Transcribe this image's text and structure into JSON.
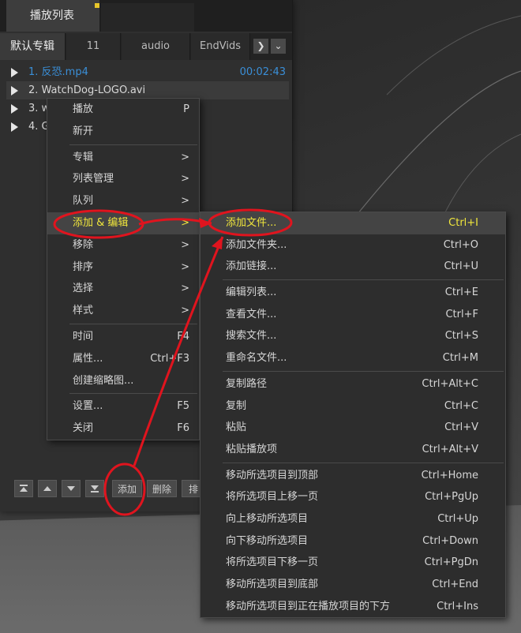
{
  "window": {
    "tab_title": "播放列表"
  },
  "album_tabs": [
    {
      "label": "默认专辑",
      "active": true
    },
    {
      "label": "11"
    },
    {
      "label": "audio"
    },
    {
      "label": "EndVids"
    }
  ],
  "nav_icons": {
    "next": "chevron-right-icon",
    "more": "chevron-down-icon"
  },
  "nav_glyphs": {
    "next": "❯",
    "more": "⌄"
  },
  "playlist": [
    {
      "label": "1. 反恐.mp4",
      "duration": "00:02:43",
      "state": "playing"
    },
    {
      "label": "2. WatchDog-LOGO.avi",
      "state": "selected"
    },
    {
      "label": "3. w"
    },
    {
      "label": "4. G"
    }
  ],
  "bottom_bar": {
    "add_label": "添加",
    "delete_label": "删除",
    "sort_label": "排"
  },
  "context_menu": [
    {
      "label": "播放",
      "shortcut": "P"
    },
    {
      "label": "新开",
      "shortcut": ""
    },
    {
      "sep": true
    },
    {
      "label": "专辑",
      "shortcut": ">"
    },
    {
      "label": "列表管理",
      "shortcut": ">"
    },
    {
      "label": "队列",
      "shortcut": ">"
    },
    {
      "label": "添加 & 编辑",
      "shortcut": ">",
      "highlighted": true
    },
    {
      "label": "移除",
      "shortcut": ">"
    },
    {
      "label": "排序",
      "shortcut": ">"
    },
    {
      "label": "选择",
      "shortcut": ">"
    },
    {
      "label": "样式",
      "shortcut": ">"
    },
    {
      "sep": true
    },
    {
      "label": "时间",
      "shortcut": "F4"
    },
    {
      "label": "属性...",
      "shortcut": "Ctrl+F3"
    },
    {
      "label": "创建缩略图...",
      "shortcut": ""
    },
    {
      "sep": true
    },
    {
      "label": "设置...",
      "shortcut": "F5"
    },
    {
      "label": "关闭",
      "shortcut": "F6"
    }
  ],
  "submenu": [
    {
      "label": "添加文件...",
      "shortcut": "Ctrl+I",
      "highlighted": true
    },
    {
      "label": "添加文件夹...",
      "shortcut": "Ctrl+O"
    },
    {
      "label": "添加链接...",
      "shortcut": "Ctrl+U"
    },
    {
      "sep": true
    },
    {
      "label": "编辑列表...",
      "shortcut": "Ctrl+E"
    },
    {
      "label": "查看文件...",
      "shortcut": "Ctrl+F"
    },
    {
      "label": "搜索文件...",
      "shortcut": "Ctrl+S"
    },
    {
      "label": "重命名文件...",
      "shortcut": "Ctrl+M"
    },
    {
      "sep": true
    },
    {
      "label": "复制路径",
      "shortcut": "Ctrl+Alt+C"
    },
    {
      "label": "复制",
      "shortcut": "Ctrl+C"
    },
    {
      "label": "粘贴",
      "shortcut": "Ctrl+V"
    },
    {
      "label": "粘贴播放项",
      "shortcut": "Ctrl+Alt+V"
    },
    {
      "sep": true
    },
    {
      "label": "移动所选项目到顶部",
      "shortcut": "Ctrl+Home"
    },
    {
      "label": "将所选项目上移一页",
      "shortcut": "Ctrl+PgUp"
    },
    {
      "label": "向上移动所选项目",
      "shortcut": "Ctrl+Up"
    },
    {
      "label": "向下移动所选项目",
      "shortcut": "Ctrl+Down"
    },
    {
      "label": "将所选项目下移一页",
      "shortcut": "Ctrl+PgDn"
    },
    {
      "label": "移动所选项目到底部",
      "shortcut": "Ctrl+End"
    },
    {
      "label": "移动所选项目到正在播放项目的下方",
      "shortcut": "Ctrl+Ins"
    }
  ],
  "colors": {
    "highlight_text": "#f0e63c",
    "playing_text": "#3a8fd8",
    "annotation": "#e0141e"
  }
}
